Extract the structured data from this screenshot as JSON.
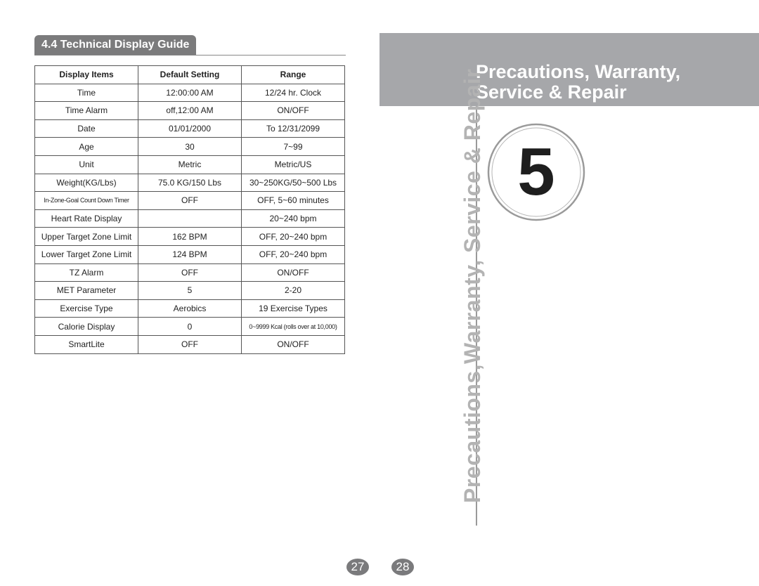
{
  "left_page": {
    "section_title": "4.4 Technical Display Guide",
    "table": {
      "headers": [
        "Display Items",
        "Default Setting",
        "Range"
      ],
      "rows": [
        [
          "Time",
          "12:00:00 AM",
          "12/24 hr. Clock"
        ],
        [
          "Time Alarm",
          "off,12:00 AM",
          "ON/OFF"
        ],
        [
          "Date",
          "01/01/2000",
          "To 12/31/2099"
        ],
        [
          "Age",
          "30",
          "7~99"
        ],
        [
          "Unit",
          "Metric",
          "Metric/US"
        ],
        [
          "Weight(KG/Lbs)",
          "75.0 KG/150 Lbs",
          "30~250KG/50~500 Lbs"
        ],
        [
          "In-Zone-Goal Count Down Timer",
          "OFF",
          "OFF, 5~60 minutes"
        ],
        [
          "Heart Rate Display",
          "",
          "20~240 bpm"
        ],
        [
          "Upper Target Zone Limit",
          "162 BPM",
          "OFF, 20~240 bpm"
        ],
        [
          "Lower Target Zone Limit",
          "124 BPM",
          "OFF, 20~240 bpm"
        ],
        [
          "TZ Alarm",
          "OFF",
          "ON/OFF"
        ],
        [
          "MET Parameter",
          "5",
          "2-20"
        ],
        [
          "Exercise Type",
          "Aerobics",
          "19 Exercise Types"
        ],
        [
          "Calorie Display",
          "0",
          "0~9999 Kcal (rolls over at 10,000)"
        ],
        [
          "SmartLite",
          "OFF",
          "ON/OFF"
        ]
      ]
    },
    "page_number": "27"
  },
  "right_page": {
    "title_line1": "Precautions, Warranty,",
    "title_line2": "Service  & Repair",
    "vertical_text": "Precautions,Warranty, Service & Repair",
    "chapter_number": "5",
    "page_number": "28"
  },
  "colors": {
    "tab_bg": "#7b7b7c",
    "banner_bg": "#a6a7aa",
    "vertical_text": "#b3b3b3",
    "page_badge": "#7a7a7c"
  }
}
